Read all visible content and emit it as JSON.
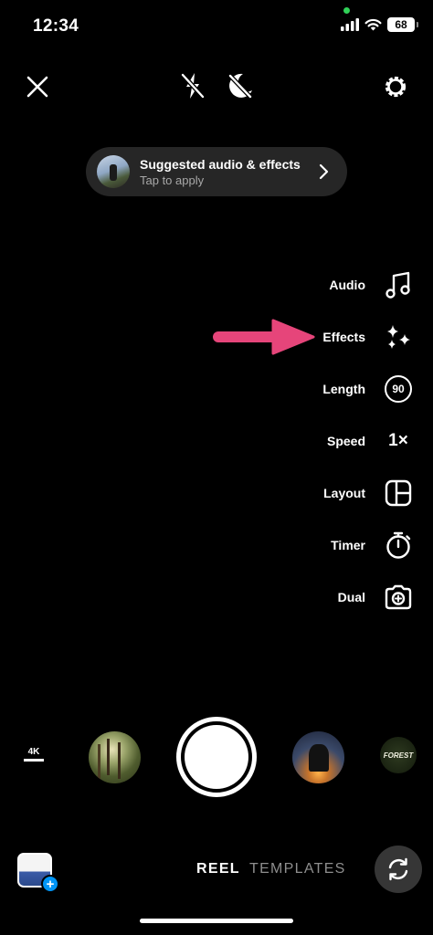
{
  "status_bar": {
    "time": "12:34",
    "battery": "68",
    "camera_indicator_color": "#30d158",
    "icons": [
      "signal-icon",
      "wifi-icon",
      "battery-icon"
    ]
  },
  "top_controls": {
    "icons": [
      "close-icon",
      "flash-off-icon",
      "night-mode-off-icon",
      "settings-icon"
    ]
  },
  "suggestion": {
    "title": "Suggested audio & effects",
    "subtitle": "Tap to apply"
  },
  "tools": [
    {
      "label": "Audio",
      "icon": "music-note-icon"
    },
    {
      "label": "Effects",
      "icon": "sparkles-icon"
    },
    {
      "label": "Length",
      "icon": "length-icon",
      "value": "90"
    },
    {
      "label": "Speed",
      "icon": "speed-icon",
      "value": "1×"
    },
    {
      "label": "Layout",
      "icon": "layout-icon"
    },
    {
      "label": "Timer",
      "icon": "timer-icon"
    },
    {
      "label": "Dual",
      "icon": "dual-camera-icon"
    }
  ],
  "annotation": {
    "arrow_color": "#e6457a",
    "points_to": "Effects"
  },
  "capture_row": {
    "quality_badge": "4K",
    "effect_thumbnails": [
      "forest-effect",
      "rider-effect",
      "forest-logo-effect"
    ],
    "forest_logo_text": "FOREST"
  },
  "bottom_bar": {
    "modes": [
      "REEL",
      "TEMPLATES"
    ],
    "active_mode": "REEL",
    "accent_color": "#0095f6"
  }
}
